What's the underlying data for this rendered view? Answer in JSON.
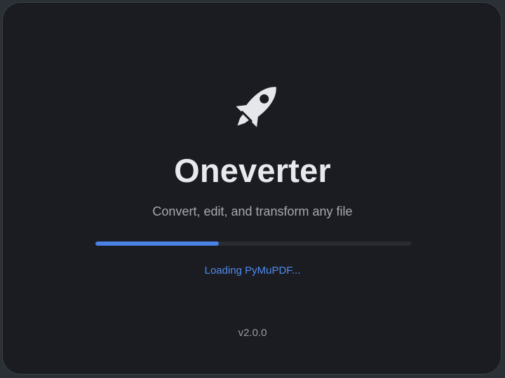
{
  "app": {
    "title": "Oneverter",
    "tagline": "Convert, edit, and transform any file",
    "logo_icon": "rocket-icon",
    "version": "v2.0.0"
  },
  "loading": {
    "status_text": "Loading PyMuPDF...",
    "progress": 0.39
  },
  "colors": {
    "background": "#1b1c21",
    "accent": "#4a82e6",
    "title": "#e8e9ed",
    "muted": "#a7a9b1"
  }
}
